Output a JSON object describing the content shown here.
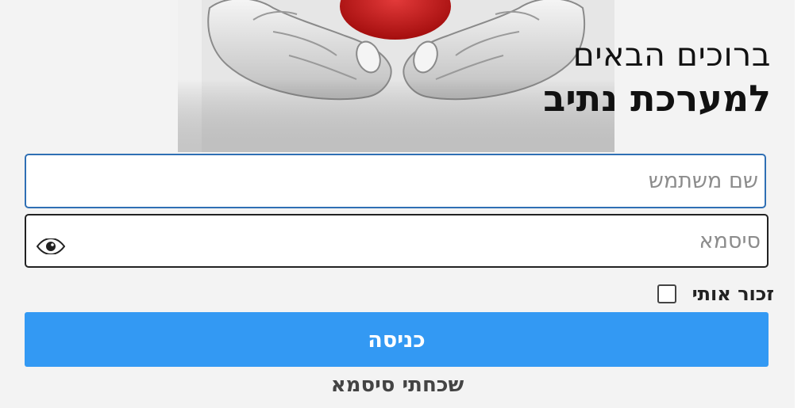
{
  "welcome": {
    "line1": "ברוכים הבאים",
    "line2": "למערכת נתיב"
  },
  "login_form": {
    "username_placeholder": "שם משתמש",
    "username_value": "",
    "password_placeholder": "סיסמא",
    "password_value": "",
    "show_password_icon": "eye-icon",
    "remember_me_label": "זכור אותי",
    "remember_me_checked": false,
    "submit_label": "כניסה",
    "forgot_password_label": "שכחתי סיסמא"
  },
  "colors": {
    "primary_button": "#3399f3",
    "focused_field_border": "#2f6fb4",
    "page_background": "#f3f3f3",
    "hero_heart": "#cc1a1a"
  }
}
